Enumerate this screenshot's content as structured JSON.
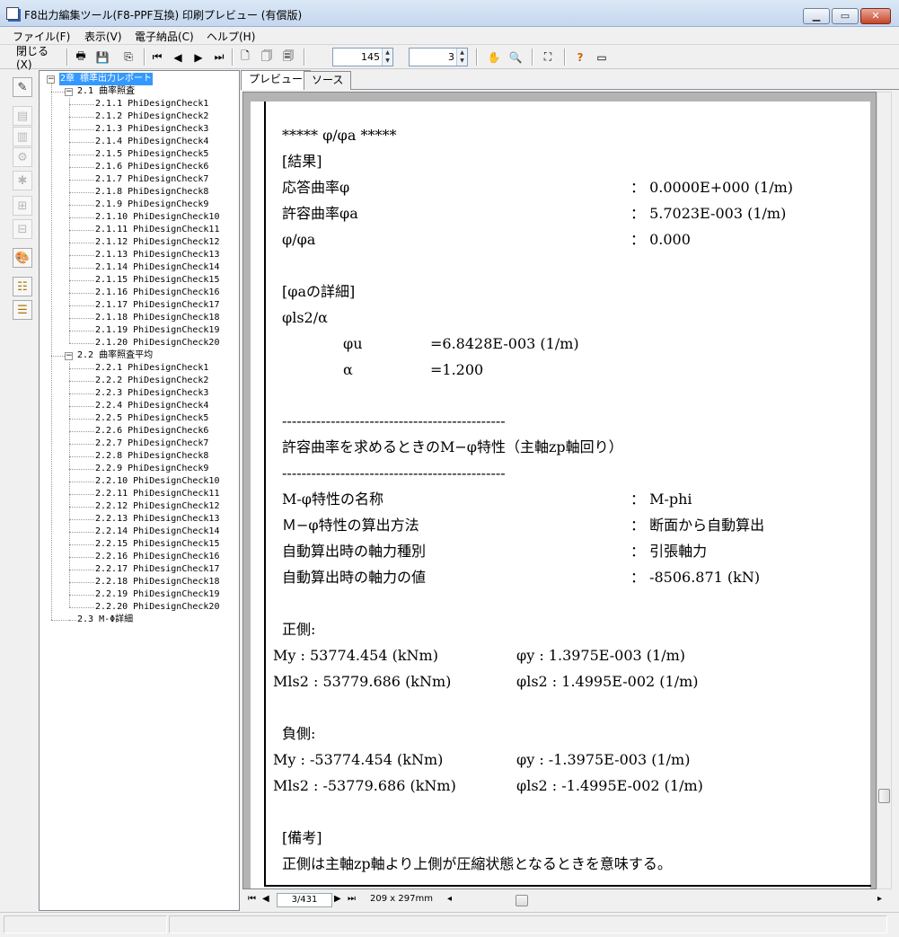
{
  "window": {
    "title": "F8出力編集ツール(F8-PPF互換) 印刷プレビュー (有償版)"
  },
  "menu": [
    "ファイル(F)",
    "表示(V)",
    "電子納品(C)",
    "ヘルプ(H)"
  ],
  "toolbar": {
    "close_label": "閉じる(X)",
    "zoom_value": "145",
    "pages_per_view": "3"
  },
  "tabs": [
    "プレビュー",
    "ソース"
  ],
  "tree": {
    "root": "2章 標準出力レポート",
    "section1": "2.1 曲率照査",
    "section1_items": [
      "2.1.1 PhiDesignCheck1",
      "2.1.2 PhiDesignCheck2",
      "2.1.3 PhiDesignCheck3",
      "2.1.4 PhiDesignCheck4",
      "2.1.5 PhiDesignCheck5",
      "2.1.6 PhiDesignCheck6",
      "2.1.7 PhiDesignCheck7",
      "2.1.8 PhiDesignCheck8",
      "2.1.9 PhiDesignCheck9",
      "2.1.10 PhiDesignCheck10",
      "2.1.11 PhiDesignCheck11",
      "2.1.12 PhiDesignCheck12",
      "2.1.13 PhiDesignCheck13",
      "2.1.14 PhiDesignCheck14",
      "2.1.15 PhiDesignCheck15",
      "2.1.16 PhiDesignCheck16",
      "2.1.17 PhiDesignCheck17",
      "2.1.18 PhiDesignCheck18",
      "2.1.19 PhiDesignCheck19",
      "2.1.20 PhiDesignCheck20"
    ],
    "section2": "2.2 曲率照査平均",
    "section2_items": [
      "2.2.1 PhiDesignCheck1",
      "2.2.2 PhiDesignCheck2",
      "2.2.3 PhiDesignCheck3",
      "2.2.4 PhiDesignCheck4",
      "2.2.5 PhiDesignCheck5",
      "2.2.6 PhiDesignCheck6",
      "2.2.7 PhiDesignCheck7",
      "2.2.8 PhiDesignCheck8",
      "2.2.9 PhiDesignCheck9",
      "2.2.10 PhiDesignCheck10",
      "2.2.11 PhiDesignCheck11",
      "2.2.12 PhiDesignCheck12",
      "2.2.13 PhiDesignCheck13",
      "2.2.14 PhiDesignCheck14",
      "2.2.15 PhiDesignCheck15",
      "2.2.16 PhiDesignCheck16",
      "2.2.17 PhiDesignCheck17",
      "2.2.18 PhiDesignCheck18",
      "2.2.19 PhiDesignCheck19",
      "2.2.20 PhiDesignCheck20"
    ],
    "section3": "2.3 M-Φ詳細"
  },
  "page": {
    "heading": "***** φ/φa *****",
    "result_label": "[結果]",
    "rows1": [
      {
        "label": "応答曲率φ",
        "value": "： 0.0000E+000 (1/m)"
      },
      {
        "label": "許容曲率φa",
        "value": "： 5.7023E-003 (1/m)"
      },
      {
        "label": "φ/φa",
        "value": "： 0.000"
      }
    ],
    "detail_label": "[φaの詳細]",
    "formula": "φls2/α",
    "phiu_label": "φu",
    "phiu_value": "=6.8428E-003 (1/m)",
    "alpha_label": "α",
    "alpha_value": "=1.200",
    "dash_line": "----------------------------------------------",
    "section_title": "許容曲率を求めるときのM−φ特性（主軸zp軸回り）",
    "rows2": [
      {
        "label": "M-φ特性の名称",
        "value": "： M-phi"
      },
      {
        "label": "Ｍ−φ特性の算出方法",
        "value": "： 断面から自動算出"
      },
      {
        "label": "自動算出時の軸力種別",
        "value": "： 引張軸力"
      },
      {
        "label": "自動算出時の軸力の値",
        "value": "： -8506.871 (kN)"
      }
    ],
    "positive_label": "正側:",
    "pos_my": "My   :  53774.454 (kNm)",
    "pos_phiy": "φy   :   1.3975E-003 (1/m)",
    "pos_mls2": "Mls2 :  53779.686 (kNm)",
    "pos_phils2": "φls2 :   1.4995E-002 (1/m)",
    "negative_label": "負側:",
    "neg_my": "My   : -53774.454 (kNm)",
    "neg_phiy": "φy   :  -1.3975E-003 (1/m)",
    "neg_mls2": "Mls2 : -53779.686 (kNm)",
    "neg_phils2": "φls2 :  -1.4995E-002 (1/m)",
    "remarks_label": "[備考]",
    "remarks_text": "正側は主軸zp軸より上側が圧縮状態となるときを意味する。"
  },
  "footer": {
    "page_indicator": "3/431",
    "paper_size": "209 x 297mm"
  }
}
